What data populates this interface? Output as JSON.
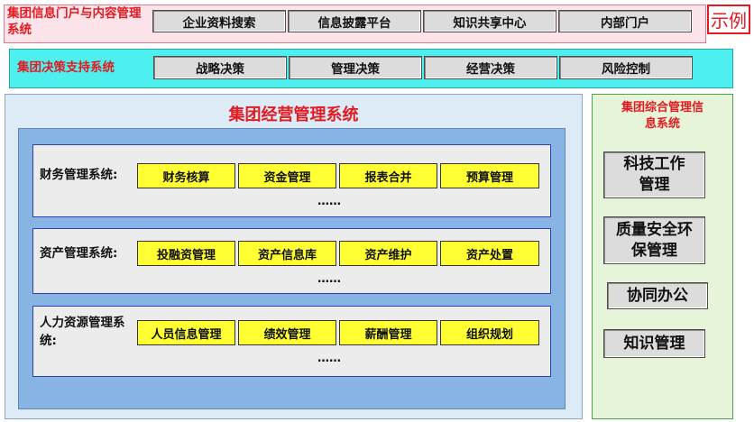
{
  "portal": {
    "title": "集团信息门户与内容管理系统",
    "items": [
      "企业资料搜索",
      "信息披露平台",
      "知识共享中心",
      "内部门户"
    ]
  },
  "example_label": "示例",
  "decision": {
    "title": "集团决策支持系统",
    "items": [
      "战略决策",
      "管理决策",
      "经营决策",
      "风险控制"
    ]
  },
  "main": {
    "title": "集团经营管理系统",
    "panels": [
      {
        "label": "财务管理系统:",
        "items": [
          "财务核算",
          "资金管理",
          "报表合并",
          "预算管理"
        ],
        "more": "……"
      },
      {
        "label": "资产管理系统:",
        "items": [
          "投融资管理",
          "资产信息库",
          "资产维护",
          "资产处置"
        ],
        "more": "……"
      },
      {
        "label": "人力资源管理系统:",
        "items": [
          "人员信息管理",
          "绩效管理",
          "薪酬管理",
          "组织规划"
        ],
        "more": "……"
      }
    ]
  },
  "side": {
    "title": "集团综合管理信息系统",
    "items": [
      "科技工作管理",
      "质量安全环保管理",
      "协同办公",
      "知识管理"
    ]
  }
}
